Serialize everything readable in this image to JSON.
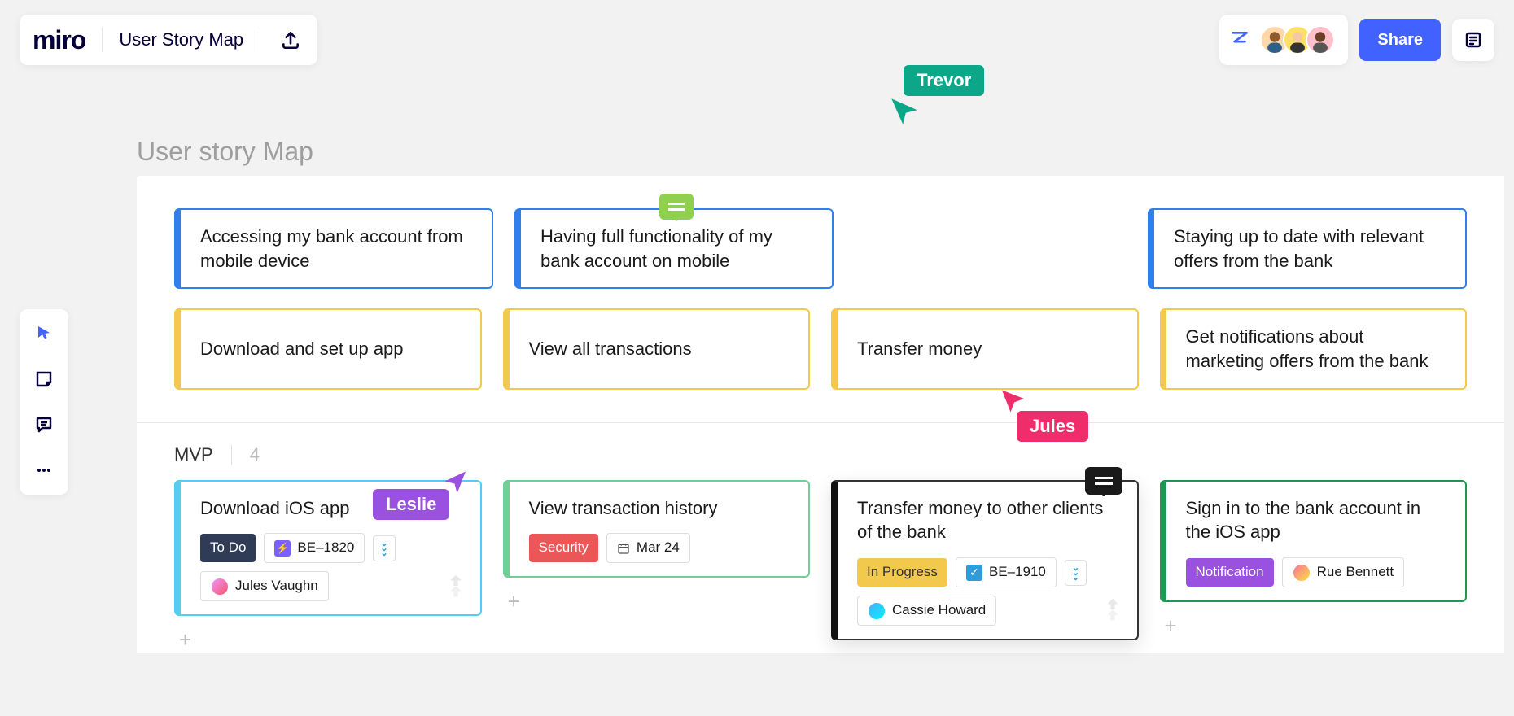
{
  "header": {
    "logo": "miro",
    "board_title": "User Story Map",
    "share_button": "Share"
  },
  "cursors": {
    "trevor": "Trevor",
    "jules": "Jules",
    "leslie": "Leslie"
  },
  "frame": {
    "label": "User story Map",
    "activities": [
      "Accessing my bank account from mobile device",
      "Having full functionality of my bank account on mobile",
      "",
      "Staying up to date with relevant offers from the bank"
    ],
    "steps": [
      "Download and set up app",
      "View all transactions",
      "Transfer money",
      "Get notifications about marketing offers from the bank"
    ],
    "section": {
      "name": "MVP",
      "count": "4"
    },
    "tasks": [
      {
        "title": "Download iOS app",
        "status": "To Do",
        "ticket": "BE–1820",
        "assignee": "Jules Vaughn"
      },
      {
        "title": "View transaction history",
        "tag": "Security",
        "date": "Mar 24"
      },
      {
        "title": "Transfer money to other clients of the bank",
        "status": "In Progress",
        "ticket": "BE–1910",
        "assignee": "Cassie Howard"
      },
      {
        "title": "Sign in to the bank account in the iOS app",
        "tag": "Notification",
        "assignee": "Rue Bennett"
      }
    ]
  }
}
